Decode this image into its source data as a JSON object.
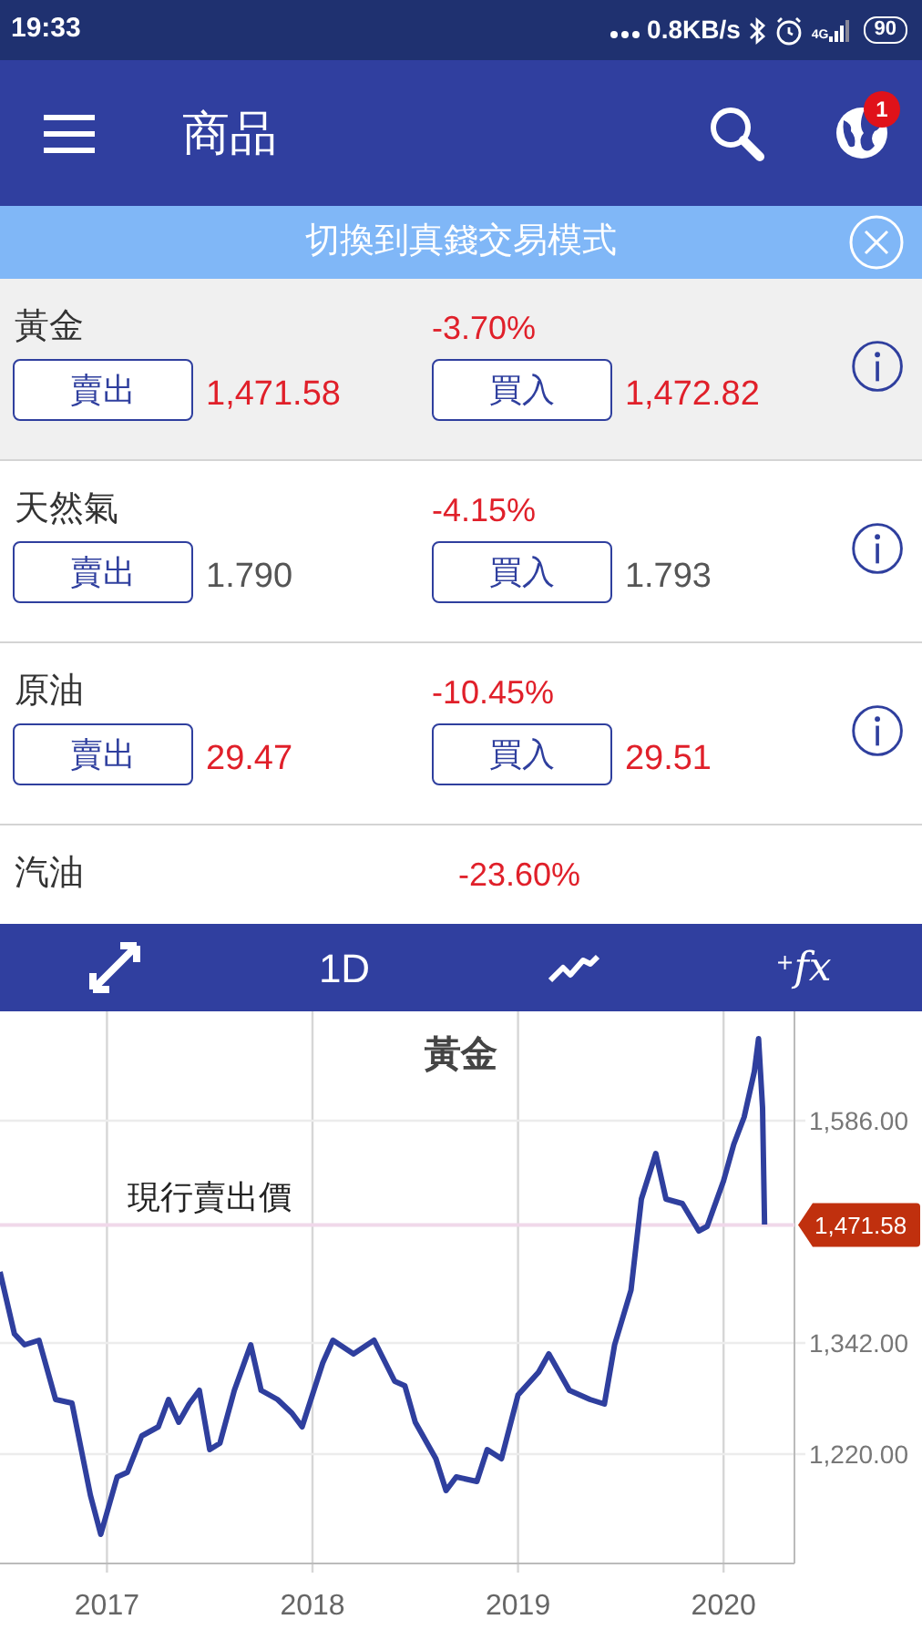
{
  "status_bar": {
    "time": "19:33",
    "speed": "0.8KB/s",
    "network": "4G",
    "battery": "90"
  },
  "app_bar": {
    "title": "商品",
    "notification_count": "1"
  },
  "banner": {
    "text": "切換到真錢交易模式"
  },
  "products": [
    {
      "name": "黃金",
      "change": "-3.70%",
      "sell_label": "賣出",
      "sell_price": "1,471.58",
      "buy_label": "買入",
      "buy_price": "1,472.82",
      "selected": true,
      "flash": true
    },
    {
      "name": "天然氣",
      "change": "-4.15%",
      "sell_label": "賣出",
      "sell_price": "1.790",
      "buy_label": "買入",
      "buy_price": "1.793",
      "selected": false,
      "flash": false
    },
    {
      "name": "原油",
      "change": "-10.45%",
      "sell_label": "賣出",
      "sell_price": "29.47",
      "buy_label": "買入",
      "buy_price": "29.51",
      "selected": false,
      "flash": true
    },
    {
      "name": "汽油",
      "change": "-23.60%",
      "selected": false
    }
  ],
  "chart_toolbar": [
    {
      "kind": "expand"
    },
    {
      "kind": "text",
      "label": "1D"
    },
    {
      "kind": "line"
    },
    {
      "kind": "text",
      "label": "$^{+}$*fx*"
    }
  ],
  "chart": {
    "chart_data": {
      "type": "line",
      "title": "黃金",
      "x": [
        2016.48,
        2016.55,
        2016.6,
        2016.67,
        2016.75,
        2016.83,
        2016.92,
        2016.97,
        2017.05,
        2017.1,
        2017.17,
        2017.25,
        2017.3,
        2017.35,
        2017.4,
        2017.45,
        2017.5,
        2017.55,
        2017.62,
        2017.7,
        2017.75,
        2017.83,
        2017.9,
        2017.95,
        2018.05,
        2018.1,
        2018.2,
        2018.3,
        2018.4,
        2018.45,
        2018.5,
        2018.6,
        2018.65,
        2018.7,
        2018.8,
        2018.85,
        2018.92,
        2019.0,
        2019.1,
        2019.15,
        2019.25,
        2019.35,
        2019.42,
        2019.47,
        2019.55,
        2019.6,
        2019.67,
        2019.72,
        2019.8,
        2019.88,
        2019.92,
        2020.0,
        2020.05,
        2020.1,
        2020.15,
        2020.17,
        2020.19,
        2020.2
      ],
      "series": [
        {
          "color": "#2f3f9e",
          "values": [
            1420,
            1352,
            1340,
            1345,
            1280,
            1276,
            1175,
            1132,
            1195,
            1200,
            1240,
            1250,
            1280,
            1255,
            1275,
            1290,
            1225,
            1232,
            1290,
            1340,
            1290,
            1280,
            1265,
            1250,
            1320,
            1345,
            1330,
            1345,
            1300,
            1295,
            1255,
            1215,
            1180,
            1195,
            1190,
            1225,
            1215,
            1285,
            1310,
            1330,
            1290,
            1280,
            1275,
            1340,
            1400,
            1500,
            1550,
            1500,
            1495,
            1465,
            1470,
            1520,
            1560,
            1590,
            1640,
            1676,
            1600,
            1472
          ]
        }
      ],
      "grid": true,
      "xlim": [
        2016.48,
        2020.345
      ],
      "ylim": [
        1100,
        1706
      ],
      "xticks": [
        {
          "value": 2017,
          "label": "2017"
        },
        {
          "value": 2018,
          "label": "2018"
        },
        {
          "value": 2019,
          "label": "2019"
        },
        {
          "value": 2020,
          "label": "2020"
        }
      ],
      "yticks": [
        {
          "value": 1220,
          "label": "1,220.00"
        },
        {
          "value": 1342,
          "label": "1,342.00"
        },
        {
          "value": 1586,
          "label": "1,586.00"
        }
      ],
      "ref_lines": [
        {
          "axis": "y",
          "value": 1471.58,
          "label": "1,471.58",
          "color": "#f0d8ea"
        }
      ],
      "annotations": [
        "現行賣出價"
      ]
    }
  }
}
